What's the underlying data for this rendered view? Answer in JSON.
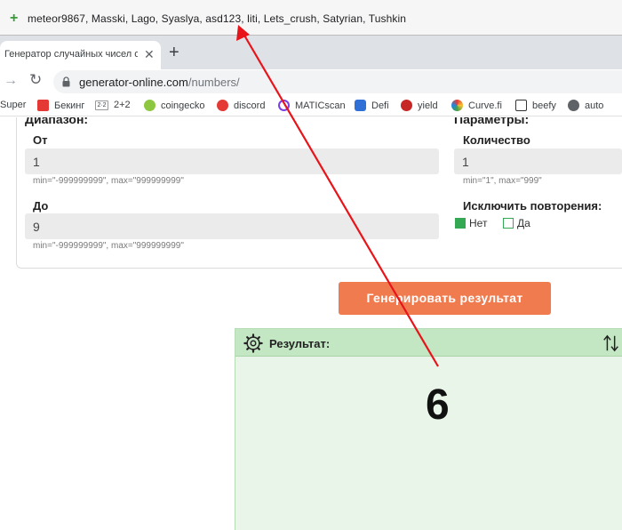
{
  "participants": {
    "text": "meteor9867, Masski, Lago, Syaslya, asd123, liti, Lets_crush, Satyrian, Tushkin"
  },
  "browser": {
    "tab_title": "Генератор случайных чисел онлайн",
    "url_host": "generator-online.com",
    "url_path": "/numbers/",
    "bookmarks": [
      {
        "label": "Super",
        "icon": "",
        "color": "#ffffff"
      },
      {
        "label": "Бекинг",
        "icon": "bekking-icon",
        "color": "#e53935"
      },
      {
        "label": "2+2",
        "icon": "2plus2-icon",
        "color": "#ffffff"
      },
      {
        "label": "coingecko",
        "icon": "coingecko-icon",
        "color": "#8dc63f"
      },
      {
        "label": "discord",
        "icon": "discord-icon",
        "color": "#e53935"
      },
      {
        "label": "MATICscan",
        "icon": "maticscan-icon",
        "color": "#7b3fe4"
      },
      {
        "label": "Defi",
        "icon": "defi-icon",
        "color": "#2f6fd6"
      },
      {
        "label": "yield",
        "icon": "yield-icon",
        "color": "#c62828"
      },
      {
        "label": "Curve.fi",
        "icon": "curve-icon",
        "color": "#e53935"
      },
      {
        "label": "beefy",
        "icon": "beefy-icon",
        "color": "#333333"
      },
      {
        "label": "auto",
        "icon": "globe-icon",
        "color": "#5f6368"
      }
    ]
  },
  "form": {
    "range_heading": "Диапазон:",
    "from_label": "От",
    "from_value": "1",
    "from_hint": "min=\"-999999999\", max=\"999999999\"",
    "to_label": "До",
    "to_value": "9",
    "to_hint": "min=\"-999999999\", max=\"999999999\"",
    "params_heading": "Параметры:",
    "count_label": "Количество",
    "count_value": "1",
    "count_hint": "min=\"1\", max=\"999\"",
    "exclude_label": "Исключить повторения:",
    "no_label": "Нет",
    "yes_label": "Да"
  },
  "generate_button": "Генерировать результат",
  "result": {
    "title": "Результат:",
    "value": "6"
  },
  "colors": {
    "accent_button": "#f07b4f",
    "result_bg": "#e8f5e8",
    "annotation_arrow": "#e8141a"
  }
}
